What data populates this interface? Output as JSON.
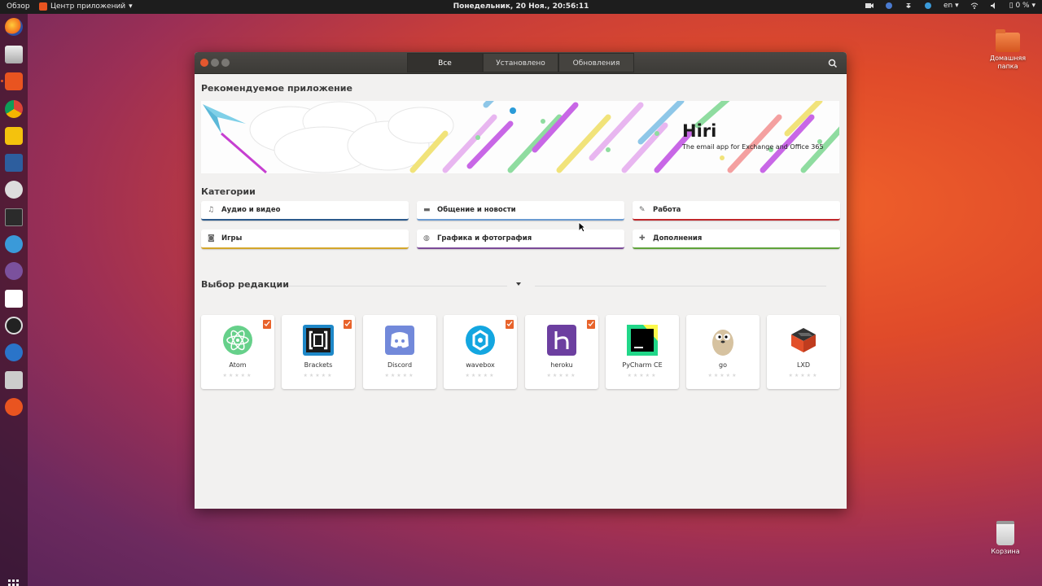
{
  "topbar": {
    "activities": "Обзор",
    "app_menu": "Центр приложений",
    "clock": "Понедельник, 20 Ноя., 20:56:11",
    "lang": "en",
    "battery": "0 %"
  },
  "desktop": {
    "home_label": "Домашняя папка",
    "trash_label": "Корзина"
  },
  "window": {
    "tabs": [
      "Все",
      "Установлено",
      "Обновления"
    ],
    "featured_heading": "Рекомендуемое приложение",
    "banner": {
      "title": "Hiri",
      "subtitle": "The email app for Exchange and Office 365"
    },
    "categories_heading": "Категории",
    "categories": [
      {
        "label": "Аудио и видео",
        "icon": "music-icon",
        "color": "#2c5a8c"
      },
      {
        "label": "Общение и новости",
        "icon": "chat-icon",
        "color": "#6b9bd1"
      },
      {
        "label": "Работа",
        "icon": "edit-icon",
        "color": "#c0282b"
      },
      {
        "label": "Игры",
        "icon": "gamepad-icon",
        "color": "#d4a62a"
      },
      {
        "label": "Графика и фотография",
        "icon": "palette-icon",
        "color": "#7b4a98"
      },
      {
        "label": "Дополнения",
        "icon": "puzzle-icon",
        "color": "#5fa33a"
      }
    ],
    "editors_heading": "Выбор редакции",
    "apps": [
      {
        "name": "Atom",
        "installed": true
      },
      {
        "name": "Brackets",
        "installed": true
      },
      {
        "name": "Discord",
        "installed": false
      },
      {
        "name": "wavebox",
        "installed": true
      },
      {
        "name": "heroku",
        "installed": true
      },
      {
        "name": "PyCharm CE",
        "installed": false
      },
      {
        "name": "go",
        "installed": false
      },
      {
        "name": "LXD",
        "installed": false
      }
    ],
    "rating_stars": "★★★★★"
  }
}
